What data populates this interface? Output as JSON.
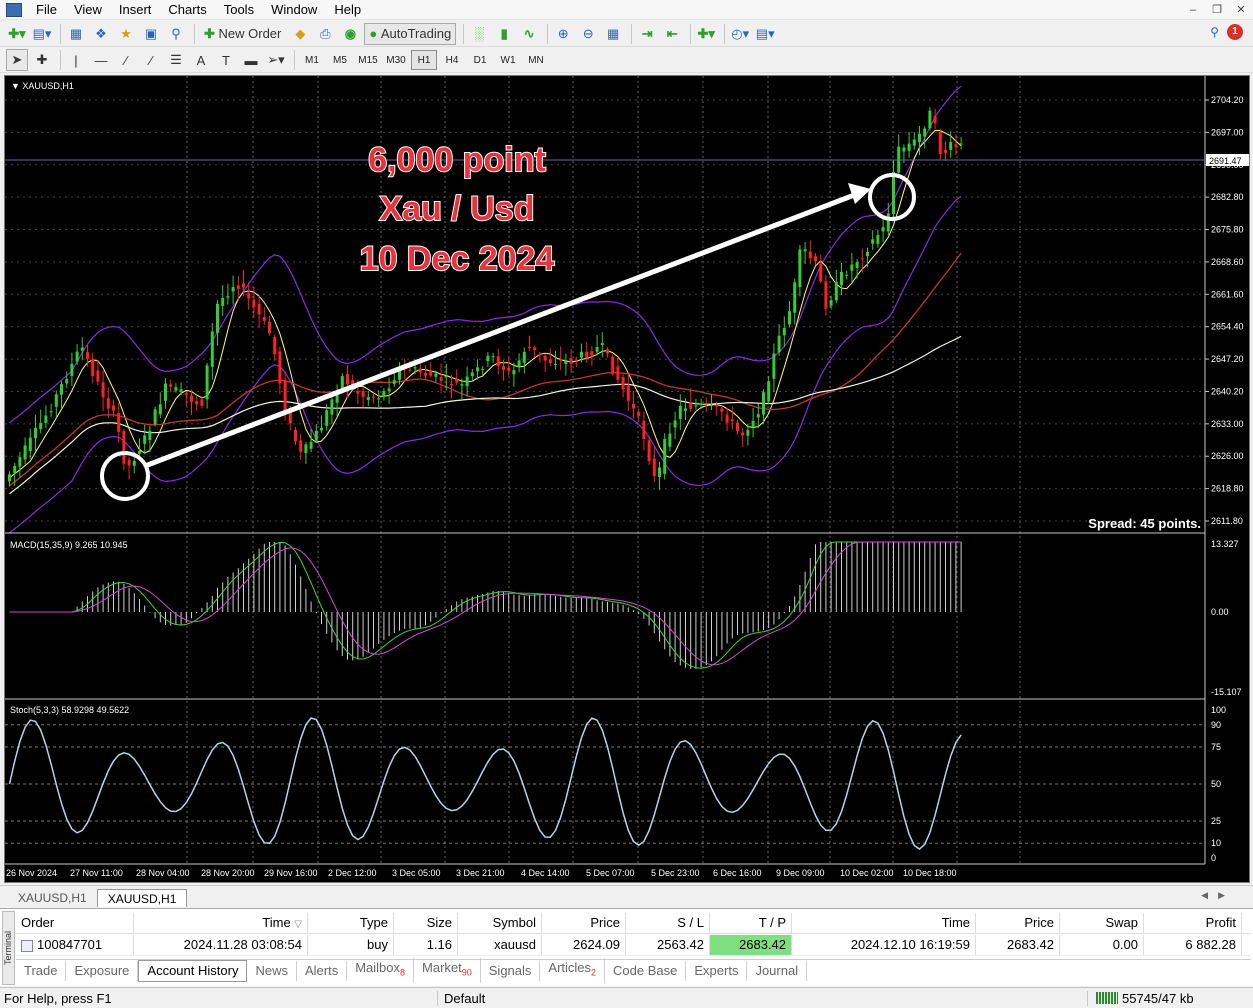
{
  "menu": {
    "items": [
      "File",
      "View",
      "Insert",
      "Charts",
      "Tools",
      "Window",
      "Help"
    ]
  },
  "toolbar": {
    "new_order": "New Order",
    "autotrading": "AutoTrading",
    "notification_count": "1"
  },
  "timeframes": [
    "M1",
    "M5",
    "M15",
    "M30",
    "H1",
    "H4",
    "D1",
    "W1",
    "MN"
  ],
  "active_timeframe": "H1",
  "chart": {
    "symbol_title": "XAUUSD,H1",
    "current_price": "2691.47",
    "spread": "Spread: 45 points.",
    "annotation": [
      "6,000 point",
      "Xau / Usd",
      "10 Dec 2024"
    ],
    "macd_label": "MACD(15,35,9) 9.265 10.945",
    "stoch_label": "Stoch(5,3,3) 58.9298 49.5622",
    "price_axis": [
      "2704.20",
      "2697.00",
      "2690.00",
      "2682.80",
      "2675.80",
      "2668.60",
      "2661.60",
      "2654.40",
      "2647.20",
      "2640.20",
      "2633.00",
      "2626.00",
      "2618.80",
      "2611.80"
    ],
    "macd_axis": [
      "13.327",
      "0.00",
      "-15.107"
    ],
    "stoch_axis": [
      "100",
      "90",
      "75",
      "50",
      "25",
      "10",
      "0"
    ],
    "time_axis": [
      "26 Nov 2024",
      "27 Nov 11:00",
      "28 Nov 04:00",
      "28 Nov 20:00",
      "29 Nov 16:00",
      "2 Dec 12:00",
      "3 Dec 05:00",
      "3 Dec 21:00",
      "4 Dec 14:00",
      "5 Dec 07:00",
      "5 Dec 23:00",
      "6 Dec 16:00",
      "9 Dec 09:00",
      "10 Dec 02:00",
      "10 Dec 18:00"
    ],
    "colors": {
      "bull": "#32cd32",
      "bear": "#ff2020",
      "bollinger": "#8a2be2",
      "annotation_text": "#e8323c"
    }
  },
  "chart_tabs": [
    "XAUUSD,H1",
    "XAUUSD,H1"
  ],
  "terminal": {
    "side_label": "Terminal",
    "headers": [
      "Order",
      "Time",
      "Type",
      "Size",
      "Symbol",
      "Price",
      "S / L",
      "T / P",
      "Time",
      "Price",
      "Swap",
      "Profit"
    ],
    "row": [
      "100847701",
      "2024.11.28 03:08:54",
      "buy",
      "1.16",
      "xauusd",
      "2624.09",
      "2563.42",
      "2683.42",
      "2024.12.10 16:19:59",
      "2683.42",
      "0.00",
      "6 882.28"
    ],
    "tabs": [
      {
        "label": "Trade",
        "badge": ""
      },
      {
        "label": "Exposure",
        "badge": ""
      },
      {
        "label": "Account History",
        "badge": ""
      },
      {
        "label": "News",
        "badge": ""
      },
      {
        "label": "Alerts",
        "badge": ""
      },
      {
        "label": "Mailbox",
        "badge": "8"
      },
      {
        "label": "Market",
        "badge": "90"
      },
      {
        "label": "Signals",
        "badge": ""
      },
      {
        "label": "Articles",
        "badge": "2"
      },
      {
        "label": "Code Base",
        "badge": ""
      },
      {
        "label": "Experts",
        "badge": ""
      },
      {
        "label": "Journal",
        "badge": ""
      }
    ]
  },
  "status": {
    "help": "For Help, press F1",
    "profile": "Default",
    "traffic": "55745/47 kb"
  }
}
